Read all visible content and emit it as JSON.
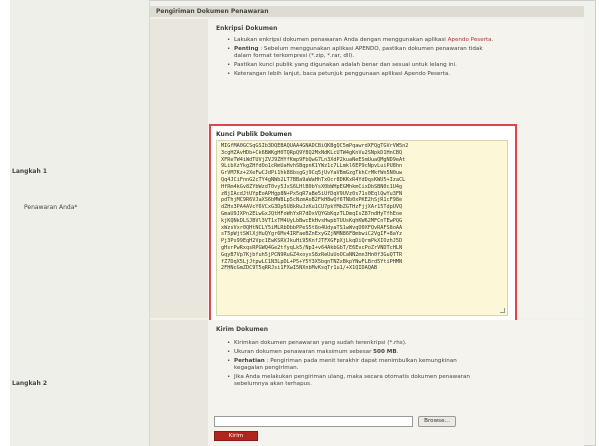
{
  "form": {
    "field_label": "Penawaran Anda*",
    "section_title": "Pengiriman Dokumen Penawaran"
  },
  "step1": {
    "label": "Langkah 1",
    "subtitle": "Enkripsi Dokumen",
    "bullets": [
      {
        "parts": [
          {
            "t": "Lakukan enkripsi dokumen penawaran Anda dengan menggunakan aplikasi ",
            "s": ""
          },
          {
            "t": "Apendo Peserta",
            "s": "link"
          },
          {
            "t": ".",
            "s": ""
          }
        ]
      },
      {
        "parts": [
          {
            "t": "Penting",
            "s": "bold"
          },
          {
            "t": " : Sebelum menggunakan aplikasi APENDO, pastikan dokumen penawaran tidak dalam format terkompresi (*.zip, *.rar, dll).",
            "s": ""
          }
        ]
      },
      {
        "parts": [
          {
            "t": "Pastikan kunci publik yang digunakan adalah benar dan sesuai untuk lelang ini.",
            "s": ""
          }
        ]
      },
      {
        "parts": [
          {
            "t": "Keterangan lebih lanjut, baca petunjuk penggunaan aplikasi Apendo Peserta.",
            "s": ""
          }
        ]
      }
    ],
    "key_title": "Kunci Publik Dokumen",
    "key_lines": [
      "MIGfMA0GCSqGSIb3DQEBAQUAA4GNADCBiQKBgQC5mPqawrdXFQgTGVrVW5n2",
      "3cgHZAvHDb+Ck6BWKgH0TQRpQ9Y8Q2MxNdKLcUTW4gKnVu2SNpkD1HnCBQ",
      "XFReTW4iWdTUVjZVJ9ZHYfKmp9FbQwG7Ln3XdP2kuaNeESmUuaQMgND9eAt",
      "9LibXzYkgZHfdOo1cRmUaHvhSBqpnK1YWz1c7LLmkl6EP9cNpvLuiPU8hn",
      "GrVM7Kz+2XeFwCJdPi1hk88bsgGj9Cq5jUvYaVBmGzgTkhCrMkfWn5N0uw",
      "Qq4JCiFnnG2cTY4gNWb2LT7BBa9aWaHhTxOcr8DKKxR4YdDqsKWU5+IzaCL",
      "HfRm4kGv8ZYbWzdT0vy5JxS6LHlB0bYsX0bWHpEGMhkmCixDbSBN0c1U4g",
      "zBjIAcdJtUYpEoAPHgp8N+Px5qR7aBe5iUfDqV9UVz0s71s0EqlQwYu3FN",
      "pdThjMC9R6VJaXS6bMW8Lp5cNzmAoB2FkH8wQf6TNb0xPKE2hSjR1cF98e",
      "dZHx3PA4AVcY6VCxG3Dp5U8kRuJzKu1CU7pkYMbZGTHzFjjXAr15TdpUVQ",
      "GmaU9JXPn2ELwGxJQtHFoWhYxR7dDxVQYGbKqzTLDmqIsZ87ndHyTfhEoe",
      "kjKQNkDLSJBVl3VT1xTM4UyLbBwcEkHvsHwpbTUUsKqhKW62MFCnTEwPQG",
      "xWzsVxr0QHtNCLY5iMLRbDbbPPeS5t8o4UdyaTS1wWvqO0XFQvRAFS8oAA",
      "sT5pWjtSWlXjHuQYgr6Mv4IRFaeBZnExyGZjNMN86F8mbwiC2VgIF+8aYz",
      "Pj3Ps99EqH2Vpc1EwKSRVJkuHi95KnfJTFXGFpXjLkqDiQrmPkXIOzhJ5D",
      "gHsrPwRxqsRPGWQ4Ge2tfyqLk5/NpI+v64AkbGbT/E6EvcPoZrVNDTcHLN",
      "GqyB7Vp7Kjbfuh5jPCN9RuGZ4xoyxS8zReUuUoOCaNN2mn3Hn0f3GuQTTR",
      "fZ7DqX5LjJtpwLC1N3LpDL+P5+Y5Y3X5bqnTNZxBkpYNwFLBrd5YtiPHMN",
      "2FHNcGmZDC9T5qRRJsi1FXwI5NXnbMvKsqTr1u1/+X1QIDAQAB"
    ]
  },
  "step2": {
    "label": "Langkah 2",
    "subtitle": "Kirim Dokumen",
    "bullets": [
      {
        "parts": [
          {
            "t": "Kirimkan dokumen penawaran yang sudah terenkripsi (*.rhs).",
            "s": ""
          }
        ]
      },
      {
        "parts": [
          {
            "t": "Ukuran dokumen penawaran maksimum sebesar ",
            "s": ""
          },
          {
            "t": "500 MB",
            "s": "bold"
          },
          {
            "t": ".",
            "s": ""
          }
        ]
      },
      {
        "parts": [
          {
            "t": "Perhatian",
            "s": "bold"
          },
          {
            "t": " : Pengiriman pada menit terakhir dapat menimbulkan kemungkinan kegagalan pengiriman.",
            "s": ""
          }
        ]
      },
      {
        "parts": [
          {
            "t": "Jika Anda melakukan pengiriman ulang, maka secara otomatis dokumen penawaran sebelumnya akan terhapus.",
            "s": ""
          }
        ]
      }
    ],
    "browse_label": "Browse...",
    "send_label": "Kirim"
  }
}
